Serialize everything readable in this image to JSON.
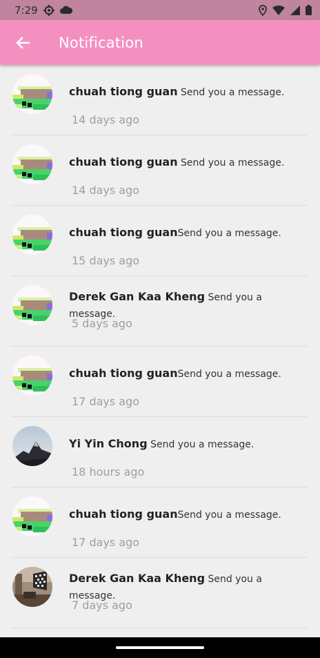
{
  "status_bar": {
    "time": "7:29",
    "left_icons": [
      "settings-gear-icon",
      "cloud-icon"
    ],
    "right_icons": [
      "location-icon",
      "wifi-icon",
      "signal-icon",
      "battery-icon"
    ]
  },
  "app_bar": {
    "title": "Notification",
    "back_icon": "arrow-left-icon",
    "color": "#f490c0"
  },
  "notifications": [
    {
      "name": "chuah tiong guan",
      "message": " Send you a message.",
      "time": "14 days ago",
      "avatar": "pixel-art"
    },
    {
      "name": "chuah tiong guan",
      "message": " Send you a message.",
      "time": "14 days ago",
      "avatar": "pixel-art"
    },
    {
      "name": "chuah tiong guan",
      "message": "Send you a message.",
      "time": "15 days ago",
      "avatar": "pixel-art"
    },
    {
      "name": "Derek Gan Kaa Kheng",
      "message": " Send you a message.",
      "time": "5 days ago",
      "avatar": "pixel-art"
    },
    {
      "name": "chuah tiong guan",
      "message": "Send you a message.",
      "time": "17 days ago",
      "avatar": "pixel-art"
    },
    {
      "name": "Yi Yin Chong",
      "message": " Send you a message.",
      "time": "18 hours ago",
      "avatar": "mountain-photo"
    },
    {
      "name": "chuah tiong guan",
      "message": "Send you a message.",
      "time": "17 days ago",
      "avatar": "pixel-art"
    },
    {
      "name": "Derek Gan Kaa Kheng",
      "message": " Send you a message.",
      "time": "7 days ago",
      "avatar": "room-photo"
    }
  ]
}
